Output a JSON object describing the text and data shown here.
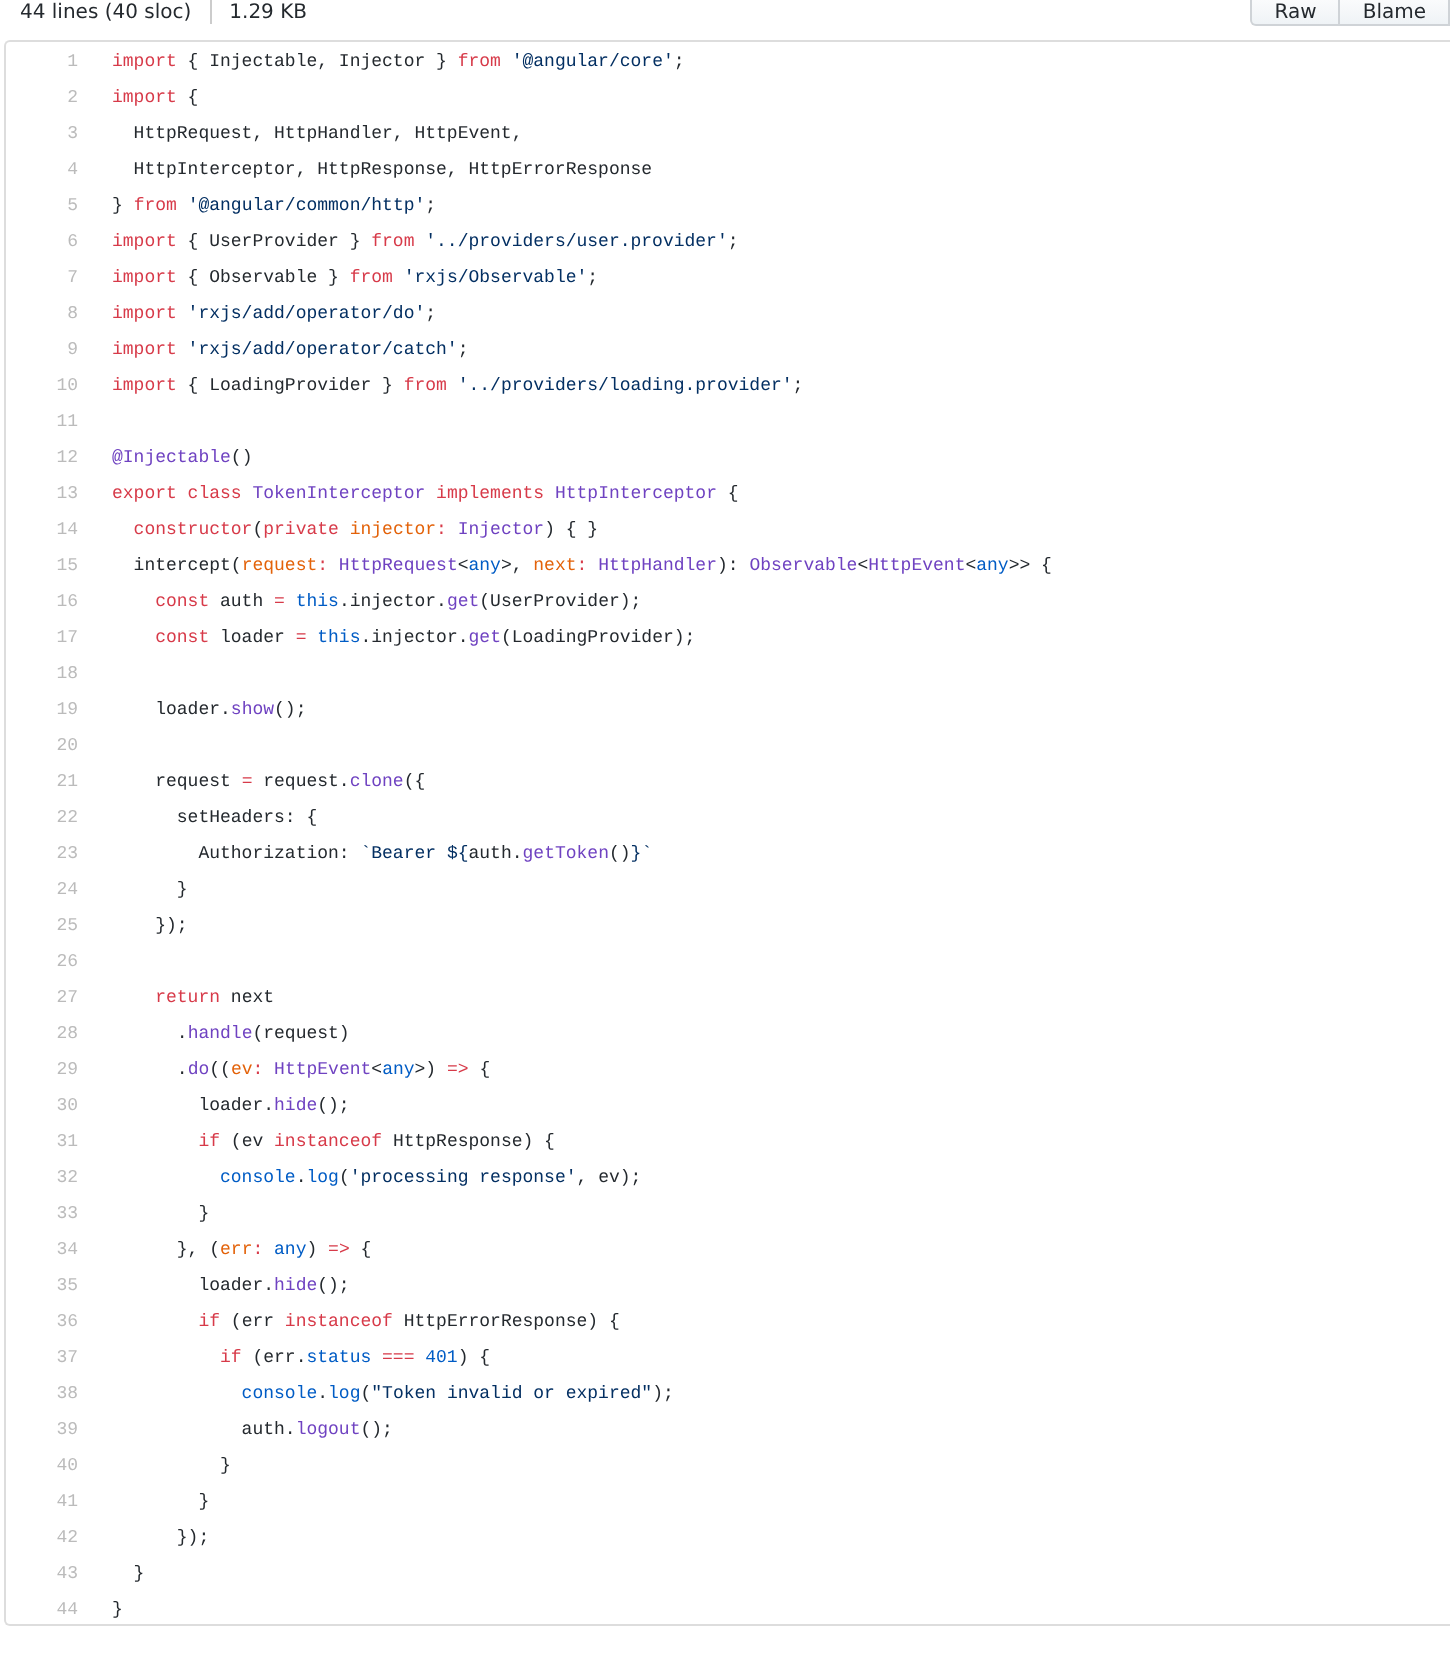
{
  "file_info": {
    "lines": "44 lines (40 sloc)",
    "size": "1.29 KB"
  },
  "actions": [
    "Raw",
    "Blame"
  ],
  "code": [
    {
      "number": "1",
      "tokens": [
        {
          "kind": "kw",
          "text": "import"
        },
        {
          "kind": "t",
          "text": " { Injectable, Injector } "
        },
        {
          "kind": "kw",
          "text": "from"
        },
        {
          "kind": "str",
          "text": " '@angular/core'"
        },
        {
          "kind": "t",
          "text": ";"
        }
      ]
    },
    {
      "number": "2",
      "tokens": [
        {
          "kind": "kw",
          "text": "import"
        },
        {
          "kind": "t",
          "text": " {"
        }
      ]
    },
    {
      "number": "3",
      "tokens": [
        {
          "kind": "t",
          "text": "  HttpRequest, HttpHandler, HttpEvent,"
        }
      ]
    },
    {
      "number": "4",
      "tokens": [
        {
          "kind": "t",
          "text": "  HttpInterceptor, HttpResponse, HttpErrorResponse"
        }
      ]
    },
    {
      "number": "5",
      "tokens": [
        {
          "kind": "t",
          "text": "} "
        },
        {
          "kind": "kw",
          "text": "from"
        },
        {
          "kind": "str",
          "text": " '@angular/common/http'"
        },
        {
          "kind": "t",
          "text": ";"
        }
      ]
    },
    {
      "number": "6",
      "tokens": [
        {
          "kind": "kw",
          "text": "import"
        },
        {
          "kind": "t",
          "text": " { UserProvider } "
        },
        {
          "kind": "kw",
          "text": "from"
        },
        {
          "kind": "str",
          "text": " '../providers/user.provider'"
        },
        {
          "kind": "t",
          "text": ";"
        }
      ]
    },
    {
      "number": "7",
      "tokens": [
        {
          "kind": "kw",
          "text": "import"
        },
        {
          "kind": "t",
          "text": " { Observable } "
        },
        {
          "kind": "kw",
          "text": "from"
        },
        {
          "kind": "str",
          "text": " 'rxjs/Observable'"
        },
        {
          "kind": "t",
          "text": ";"
        }
      ]
    },
    {
      "number": "8",
      "tokens": [
        {
          "kind": "kw",
          "text": "import"
        },
        {
          "kind": "str",
          "text": " 'rxjs/add/operator/do'"
        },
        {
          "kind": "t",
          "text": ";"
        }
      ]
    },
    {
      "number": "9",
      "tokens": [
        {
          "kind": "kw",
          "text": "import"
        },
        {
          "kind": "str",
          "text": " 'rxjs/add/operator/catch'"
        },
        {
          "kind": "t",
          "text": ";"
        }
      ]
    },
    {
      "number": "10",
      "tokens": [
        {
          "kind": "kw",
          "text": "import"
        },
        {
          "kind": "t",
          "text": " { LoadingProvider } "
        },
        {
          "kind": "kw",
          "text": "from"
        },
        {
          "kind": "str",
          "text": " '../providers/loading.provider'"
        },
        {
          "kind": "t",
          "text": ";"
        }
      ]
    },
    {
      "number": "11"
    },
    {
      "number": "12",
      "tokens": [
        {
          "kind": "fn",
          "text": "@Injectable"
        },
        {
          "kind": "t",
          "text": "()"
        }
      ]
    },
    {
      "number": "13",
      "tokens": [
        {
          "kind": "kw",
          "text": "export"
        },
        {
          "kind": "kw",
          "text": " class"
        },
        {
          "kind": "fn",
          "text": " TokenInterceptor"
        },
        {
          "kind": "kw",
          "text": " implements"
        },
        {
          "kind": "fn",
          "text": " HttpInterceptor"
        },
        {
          "kind": "t",
          "text": " {"
        }
      ]
    },
    {
      "number": "14",
      "tokens": [
        {
          "kind": "kw",
          "text": "  constructor"
        },
        {
          "kind": "t",
          "text": "("
        },
        {
          "kind": "kw",
          "text": "private"
        },
        {
          "kind": "p",
          "text": " injector"
        },
        {
          "kind": "kw",
          "text": ":"
        },
        {
          "kind": "fn",
          "text": " Injector"
        },
        {
          "kind": "t",
          "text": ") { }"
        }
      ]
    },
    {
      "number": "15",
      "tokens": [
        {
          "kind": "t",
          "text": "  intercept("
        },
        {
          "kind": "p",
          "text": "request"
        },
        {
          "kind": "kw",
          "text": ":"
        },
        {
          "kind": "fn",
          "text": " HttpRequest"
        },
        {
          "kind": "t",
          "text": "<"
        },
        {
          "kind": "c",
          "text": "any"
        },
        {
          "kind": "t",
          "text": ">, "
        },
        {
          "kind": "p",
          "text": "next"
        },
        {
          "kind": "kw",
          "text": ":"
        },
        {
          "kind": "fn",
          "text": " HttpHandler"
        },
        {
          "kind": "t",
          "text": "): "
        },
        {
          "kind": "fn",
          "text": "Observable"
        },
        {
          "kind": "t",
          "text": "<"
        },
        {
          "kind": "fn",
          "text": "HttpEvent"
        },
        {
          "kind": "t",
          "text": "<"
        },
        {
          "kind": "c",
          "text": "any"
        },
        {
          "kind": "t",
          "text": ">> {"
        }
      ]
    },
    {
      "number": "16",
      "tokens": [
        {
          "kind": "kw",
          "text": "    const"
        },
        {
          "kind": "t",
          "text": " auth "
        },
        {
          "kind": "kw",
          "text": "="
        },
        {
          "kind": "c",
          "text": " this"
        },
        {
          "kind": "t",
          "text": ".injector."
        },
        {
          "kind": "fn",
          "text": "get"
        },
        {
          "kind": "t",
          "text": "(UserProvider);"
        }
      ]
    },
    {
      "number": "17",
      "tokens": [
        {
          "kind": "kw",
          "text": "    const"
        },
        {
          "kind": "t",
          "text": " loader "
        },
        {
          "kind": "kw",
          "text": "="
        },
        {
          "kind": "c",
          "text": " this"
        },
        {
          "kind": "t",
          "text": ".injector."
        },
        {
          "kind": "fn",
          "text": "get"
        },
        {
          "kind": "t",
          "text": "(LoadingProvider);"
        }
      ]
    },
    {
      "number": "18"
    },
    {
      "number": "19",
      "tokens": [
        {
          "kind": "t",
          "text": "    loader."
        },
        {
          "kind": "fn",
          "text": "show"
        },
        {
          "kind": "t",
          "text": "();"
        }
      ]
    },
    {
      "number": "20"
    },
    {
      "number": "21",
      "tokens": [
        {
          "kind": "t",
          "text": "    request "
        },
        {
          "kind": "kw",
          "text": "="
        },
        {
          "kind": "t",
          "text": " request."
        },
        {
          "kind": "fn",
          "text": "clone"
        },
        {
          "kind": "t",
          "text": "({"
        }
      ]
    },
    {
      "number": "22",
      "tokens": [
        {
          "kind": "t",
          "text": "      setHeaders: {"
        }
      ]
    },
    {
      "number": "23",
      "tokens": [
        {
          "kind": "t",
          "text": "        Authorization: "
        },
        {
          "kind": "str",
          "text": "`Bearer ${"
        },
        {
          "kind": "t",
          "text": "auth."
        },
        {
          "kind": "fn",
          "text": "getToken"
        },
        {
          "kind": "t",
          "text": "()"
        },
        {
          "kind": "str",
          "text": "}`"
        }
      ]
    },
    {
      "number": "24",
      "tokens": [
        {
          "kind": "t",
          "text": "      }"
        }
      ]
    },
    {
      "number": "25",
      "tokens": [
        {
          "kind": "t",
          "text": "    });"
        }
      ]
    },
    {
      "number": "26"
    },
    {
      "number": "27",
      "tokens": [
        {
          "kind": "kw",
          "text": "    return"
        },
        {
          "kind": "t",
          "text": " next"
        }
      ]
    },
    {
      "number": "28",
      "tokens": [
        {
          "kind": "t",
          "text": "      ."
        },
        {
          "kind": "fn",
          "text": "handle"
        },
        {
          "kind": "t",
          "text": "(request)"
        }
      ]
    },
    {
      "number": "29",
      "tokens": [
        {
          "kind": "t",
          "text": "      ."
        },
        {
          "kind": "fn",
          "text": "do"
        },
        {
          "kind": "t",
          "text": "(("
        },
        {
          "kind": "p",
          "text": "ev"
        },
        {
          "kind": "kw",
          "text": ":"
        },
        {
          "kind": "fn",
          "text": " HttpEvent"
        },
        {
          "kind": "t",
          "text": "<"
        },
        {
          "kind": "c",
          "text": "any"
        },
        {
          "kind": "t",
          "text": ">) "
        },
        {
          "kind": "kw",
          "text": "=>"
        },
        {
          "kind": "t",
          "text": " {"
        }
      ]
    },
    {
      "number": "30",
      "tokens": [
        {
          "kind": "t",
          "text": "        loader."
        },
        {
          "kind": "fn",
          "text": "hide"
        },
        {
          "kind": "t",
          "text": "();"
        }
      ]
    },
    {
      "number": "31",
      "tokens": [
        {
          "kind": "kw",
          "text": "        if"
        },
        {
          "kind": "t",
          "text": " (ev "
        },
        {
          "kind": "kw",
          "text": "instanceof"
        },
        {
          "kind": "t",
          "text": " HttpResponse) {"
        }
      ]
    },
    {
      "number": "32",
      "tokens": [
        {
          "kind": "c",
          "text": "          console"
        },
        {
          "kind": "t",
          "text": "."
        },
        {
          "kind": "c",
          "text": "log"
        },
        {
          "kind": "t",
          "text": "("
        },
        {
          "kind": "str",
          "text": "'processing response'"
        },
        {
          "kind": "t",
          "text": ", ev);"
        }
      ]
    },
    {
      "number": "33",
      "tokens": [
        {
          "kind": "t",
          "text": "        }"
        }
      ]
    },
    {
      "number": "34",
      "tokens": [
        {
          "kind": "t",
          "text": "      }, ("
        },
        {
          "kind": "p",
          "text": "err"
        },
        {
          "kind": "kw",
          "text": ":"
        },
        {
          "kind": "c",
          "text": " any"
        },
        {
          "kind": "t",
          "text": ") "
        },
        {
          "kind": "kw",
          "text": "=>"
        },
        {
          "kind": "t",
          "text": " {"
        }
      ]
    },
    {
      "number": "35",
      "tokens": [
        {
          "kind": "t",
          "text": "        loader."
        },
        {
          "kind": "fn",
          "text": "hide"
        },
        {
          "kind": "t",
          "text": "();"
        }
      ]
    },
    {
      "number": "36",
      "tokens": [
        {
          "kind": "kw",
          "text": "        if"
        },
        {
          "kind": "t",
          "text": " (err "
        },
        {
          "kind": "kw",
          "text": "instanceof"
        },
        {
          "kind": "t",
          "text": " HttpErrorResponse) {"
        }
      ]
    },
    {
      "number": "37",
      "tokens": [
        {
          "kind": "kw",
          "text": "          if"
        },
        {
          "kind": "t",
          "text": " (err."
        },
        {
          "kind": "c",
          "text": "status"
        },
        {
          "kind": "kw",
          "text": " ==="
        },
        {
          "kind": "c",
          "text": " 401"
        },
        {
          "kind": "t",
          "text": ") {"
        }
      ]
    },
    {
      "number": "38",
      "tokens": [
        {
          "kind": "c",
          "text": "            console"
        },
        {
          "kind": "t",
          "text": "."
        },
        {
          "kind": "c",
          "text": "log"
        },
        {
          "kind": "t",
          "text": "("
        },
        {
          "kind": "str",
          "text": "\"Token invalid or expired\""
        },
        {
          "kind": "t",
          "text": ");"
        }
      ]
    },
    {
      "number": "39",
      "tokens": [
        {
          "kind": "t",
          "text": "            auth."
        },
        {
          "kind": "fn",
          "text": "logout"
        },
        {
          "kind": "t",
          "text": "();"
        }
      ]
    },
    {
      "number": "40",
      "tokens": [
        {
          "kind": "t",
          "text": "          }"
        }
      ]
    },
    {
      "number": "41",
      "tokens": [
        {
          "kind": "t",
          "text": "        }"
        }
      ]
    },
    {
      "number": "42",
      "tokens": [
        {
          "kind": "t",
          "text": "      });"
        }
      ]
    },
    {
      "number": "43",
      "tokens": [
        {
          "kind": "t",
          "text": "  }"
        }
      ]
    },
    {
      "number": "44",
      "tokens": [
        {
          "kind": "t",
          "text": "}"
        }
      ]
    }
  ]
}
